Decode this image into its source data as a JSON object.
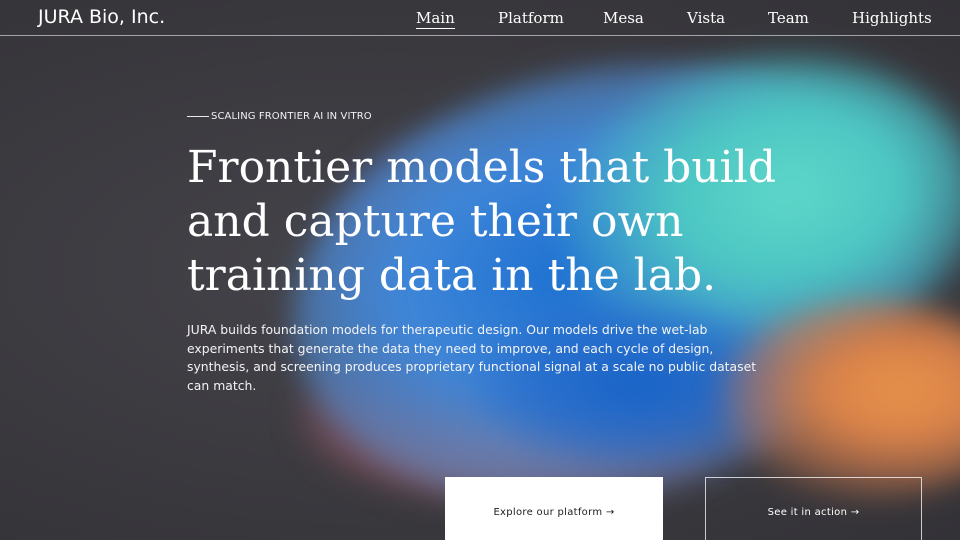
{
  "header": {
    "brand": "JURA Bio, Inc.",
    "nav": [
      {
        "label": "Main",
        "active": true
      },
      {
        "label": "Platform",
        "active": false
      },
      {
        "label": "Mesa",
        "active": false
      },
      {
        "label": "Vista",
        "active": false
      },
      {
        "label": "Team",
        "active": false
      },
      {
        "label": "Highlights",
        "active": false
      }
    ]
  },
  "hero": {
    "eyebrow": "SCALING FRONTIER AI IN VITRO",
    "headline": "Frontier models that build and capture their own training data in the lab.",
    "intro": "JURA builds foundation models for therapeutic design. Our models drive the wet-lab experiments that generate the data they need to improve, and each cycle of design, synthesis, and screening produces proprietary functional signal at a scale no public dataset can match.",
    "primary_cta": "Explore our platform →",
    "secondary_cta": "See it in action →"
  },
  "colors": {
    "background": "#3a393e",
    "text": "#ffffff",
    "button_fill": "#ffffff",
    "button_text": "#1d1d22",
    "blob_blue": "#1b6fd1",
    "blob_teal": "#5fd7c9",
    "blob_orange": "#e8924a"
  }
}
